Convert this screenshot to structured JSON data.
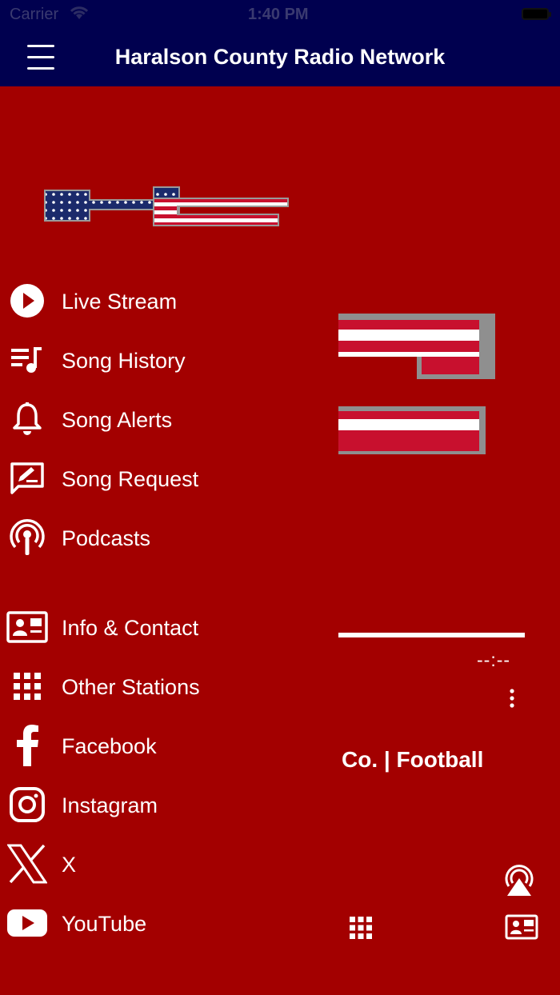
{
  "status_bar": {
    "carrier": "Carrier",
    "time": "1:40 PM"
  },
  "nav": {
    "title": "Haralson County Radio Network",
    "menu_icon": "hamburger-menu-icon"
  },
  "menu": {
    "items": [
      {
        "label": "Live Stream",
        "icon": "play-circle-icon"
      },
      {
        "label": "Song History",
        "icon": "song-history-icon"
      },
      {
        "label": "Song Alerts",
        "icon": "bell-icon"
      },
      {
        "label": "Song Request",
        "icon": "request-edit-icon"
      },
      {
        "label": "Podcasts",
        "icon": "podcast-icon"
      },
      {
        "label": "Info & Contact",
        "icon": "contact-card-icon"
      },
      {
        "label": "Other Stations",
        "icon": "grid-icon"
      },
      {
        "label": "Facebook",
        "icon": "facebook-icon"
      },
      {
        "label": "Instagram",
        "icon": "instagram-icon"
      },
      {
        "label": "X",
        "icon": "x-icon"
      },
      {
        "label": "YouTube",
        "icon": "youtube-icon"
      }
    ]
  },
  "player": {
    "time": "--:--",
    "now_playing": "Co. | Football"
  },
  "colors": {
    "background": "#a30000",
    "navbar": "#00004f",
    "text": "#ffffff"
  }
}
